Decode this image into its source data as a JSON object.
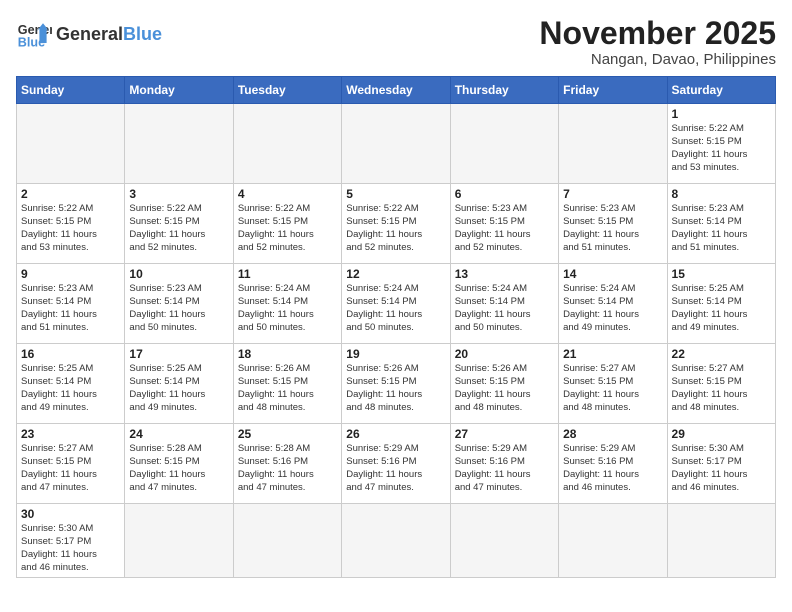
{
  "header": {
    "logo_general": "General",
    "logo_blue": "Blue",
    "month_title": "November 2025",
    "subtitle": "Nangan, Davao, Philippines"
  },
  "weekdays": [
    "Sunday",
    "Monday",
    "Tuesday",
    "Wednesday",
    "Thursday",
    "Friday",
    "Saturday"
  ],
  "weeks": [
    [
      {
        "day": "",
        "info": ""
      },
      {
        "day": "",
        "info": ""
      },
      {
        "day": "",
        "info": ""
      },
      {
        "day": "",
        "info": ""
      },
      {
        "day": "",
        "info": ""
      },
      {
        "day": "",
        "info": ""
      },
      {
        "day": "1",
        "info": "Sunrise: 5:22 AM\nSunset: 5:15 PM\nDaylight: 11 hours\nand 53 minutes."
      }
    ],
    [
      {
        "day": "2",
        "info": "Sunrise: 5:22 AM\nSunset: 5:15 PM\nDaylight: 11 hours\nand 53 minutes."
      },
      {
        "day": "3",
        "info": "Sunrise: 5:22 AM\nSunset: 5:15 PM\nDaylight: 11 hours\nand 52 minutes."
      },
      {
        "day": "4",
        "info": "Sunrise: 5:22 AM\nSunset: 5:15 PM\nDaylight: 11 hours\nand 52 minutes."
      },
      {
        "day": "5",
        "info": "Sunrise: 5:22 AM\nSunset: 5:15 PM\nDaylight: 11 hours\nand 52 minutes."
      },
      {
        "day": "6",
        "info": "Sunrise: 5:23 AM\nSunset: 5:15 PM\nDaylight: 11 hours\nand 52 minutes."
      },
      {
        "day": "7",
        "info": "Sunrise: 5:23 AM\nSunset: 5:15 PM\nDaylight: 11 hours\nand 51 minutes."
      },
      {
        "day": "8",
        "info": "Sunrise: 5:23 AM\nSunset: 5:14 PM\nDaylight: 11 hours\nand 51 minutes."
      }
    ],
    [
      {
        "day": "9",
        "info": "Sunrise: 5:23 AM\nSunset: 5:14 PM\nDaylight: 11 hours\nand 51 minutes."
      },
      {
        "day": "10",
        "info": "Sunrise: 5:23 AM\nSunset: 5:14 PM\nDaylight: 11 hours\nand 50 minutes."
      },
      {
        "day": "11",
        "info": "Sunrise: 5:24 AM\nSunset: 5:14 PM\nDaylight: 11 hours\nand 50 minutes."
      },
      {
        "day": "12",
        "info": "Sunrise: 5:24 AM\nSunset: 5:14 PM\nDaylight: 11 hours\nand 50 minutes."
      },
      {
        "day": "13",
        "info": "Sunrise: 5:24 AM\nSunset: 5:14 PM\nDaylight: 11 hours\nand 50 minutes."
      },
      {
        "day": "14",
        "info": "Sunrise: 5:24 AM\nSunset: 5:14 PM\nDaylight: 11 hours\nand 49 minutes."
      },
      {
        "day": "15",
        "info": "Sunrise: 5:25 AM\nSunset: 5:14 PM\nDaylight: 11 hours\nand 49 minutes."
      }
    ],
    [
      {
        "day": "16",
        "info": "Sunrise: 5:25 AM\nSunset: 5:14 PM\nDaylight: 11 hours\nand 49 minutes."
      },
      {
        "day": "17",
        "info": "Sunrise: 5:25 AM\nSunset: 5:14 PM\nDaylight: 11 hours\nand 49 minutes."
      },
      {
        "day": "18",
        "info": "Sunrise: 5:26 AM\nSunset: 5:15 PM\nDaylight: 11 hours\nand 48 minutes."
      },
      {
        "day": "19",
        "info": "Sunrise: 5:26 AM\nSunset: 5:15 PM\nDaylight: 11 hours\nand 48 minutes."
      },
      {
        "day": "20",
        "info": "Sunrise: 5:26 AM\nSunset: 5:15 PM\nDaylight: 11 hours\nand 48 minutes."
      },
      {
        "day": "21",
        "info": "Sunrise: 5:27 AM\nSunset: 5:15 PM\nDaylight: 11 hours\nand 48 minutes."
      },
      {
        "day": "22",
        "info": "Sunrise: 5:27 AM\nSunset: 5:15 PM\nDaylight: 11 hours\nand 48 minutes."
      }
    ],
    [
      {
        "day": "23",
        "info": "Sunrise: 5:27 AM\nSunset: 5:15 PM\nDaylight: 11 hours\nand 47 minutes."
      },
      {
        "day": "24",
        "info": "Sunrise: 5:28 AM\nSunset: 5:15 PM\nDaylight: 11 hours\nand 47 minutes."
      },
      {
        "day": "25",
        "info": "Sunrise: 5:28 AM\nSunset: 5:16 PM\nDaylight: 11 hours\nand 47 minutes."
      },
      {
        "day": "26",
        "info": "Sunrise: 5:29 AM\nSunset: 5:16 PM\nDaylight: 11 hours\nand 47 minutes."
      },
      {
        "day": "27",
        "info": "Sunrise: 5:29 AM\nSunset: 5:16 PM\nDaylight: 11 hours\nand 47 minutes."
      },
      {
        "day": "28",
        "info": "Sunrise: 5:29 AM\nSunset: 5:16 PM\nDaylight: 11 hours\nand 46 minutes."
      },
      {
        "day": "29",
        "info": "Sunrise: 5:30 AM\nSunset: 5:17 PM\nDaylight: 11 hours\nand 46 minutes."
      }
    ],
    [
      {
        "day": "30",
        "info": "Sunrise: 5:30 AM\nSunset: 5:17 PM\nDaylight: 11 hours\nand 46 minutes."
      },
      {
        "day": "",
        "info": ""
      },
      {
        "day": "",
        "info": ""
      },
      {
        "day": "",
        "info": ""
      },
      {
        "day": "",
        "info": ""
      },
      {
        "day": "",
        "info": ""
      },
      {
        "day": "",
        "info": ""
      }
    ]
  ]
}
